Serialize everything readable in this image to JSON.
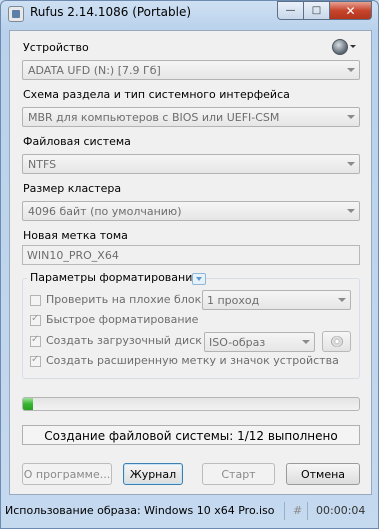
{
  "window": {
    "title": "Rufus 2.14.1086 (Portable)",
    "minimize": "—",
    "maximize": "□",
    "close": "✕"
  },
  "device": {
    "label": "Устройство",
    "value": "ADATA UFD (N:) [7.9 Гб]"
  },
  "partition": {
    "label": "Схема раздела и тип системного интерфейса",
    "value": "MBR для компьютеров с BIOS или UEFI-CSM"
  },
  "filesystem": {
    "label": "Файловая система",
    "value": "NTFS"
  },
  "cluster": {
    "label": "Размер кластера",
    "value": "4096 байт (по умолчанию)"
  },
  "volume": {
    "label": "Новая метка тома",
    "value": "WIN10_PRO_X64"
  },
  "format_options": {
    "title": "Параметры форматирования",
    "bad_blocks": {
      "label": "Проверить на плохие блоки",
      "checked": false,
      "passes": "1 проход"
    },
    "quick_format": {
      "label": "Быстрое форматирование",
      "checked": true
    },
    "bootable": {
      "label": "Создать загрузочный диск",
      "checked": true,
      "type": "ISO-образ"
    },
    "extended_label": {
      "label": "Создать расширенную метку и значок устройства",
      "checked": true
    }
  },
  "progress": {
    "percent": 3
  },
  "status": "Создание файловой системы: 1/12 выполнено",
  "buttons": {
    "about": "О программе...",
    "log": "Журнал",
    "start": "Старт",
    "cancel": "Отмена"
  },
  "statusbar": {
    "image": "Использование образа: Windows 10 x64 Pro.iso",
    "hash": "#",
    "time": "00:00:04"
  }
}
